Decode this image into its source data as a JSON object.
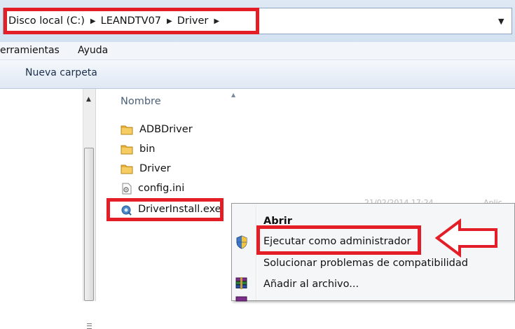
{
  "breadcrumb": {
    "items": [
      "Disco local (C:)",
      "LEANDTV07",
      "Driver"
    ],
    "separator": "▶"
  },
  "menubar": {
    "items": [
      "erramientas",
      "Ayuda"
    ]
  },
  "toolbar": {
    "new_folder_label": "Nueva carpeta"
  },
  "file_list": {
    "column_name": "Nombre",
    "items": [
      {
        "name": "ADBDriver",
        "icon": "folder-icon"
      },
      {
        "name": "bin",
        "icon": "folder-icon"
      },
      {
        "name": "Driver",
        "icon": "folder-icon"
      },
      {
        "name": "config.ini",
        "icon": "ini-file-icon"
      },
      {
        "name": "DriverInstall.exe",
        "icon": "exe-file-icon"
      }
    ]
  },
  "context_menu": {
    "items": [
      {
        "label": "Abrir",
        "bold": true
      },
      {
        "label": "Ejecutar como administrador",
        "icon": "uac-shield-icon"
      },
      {
        "label": "Solucionar problemas de compatibilidad"
      },
      {
        "label": "Añadir al archivo...",
        "icon": "winrar-icon"
      }
    ]
  },
  "colors": {
    "annotation_red": "#e41e26",
    "address_bar_bg": "#dfe9f5"
  }
}
